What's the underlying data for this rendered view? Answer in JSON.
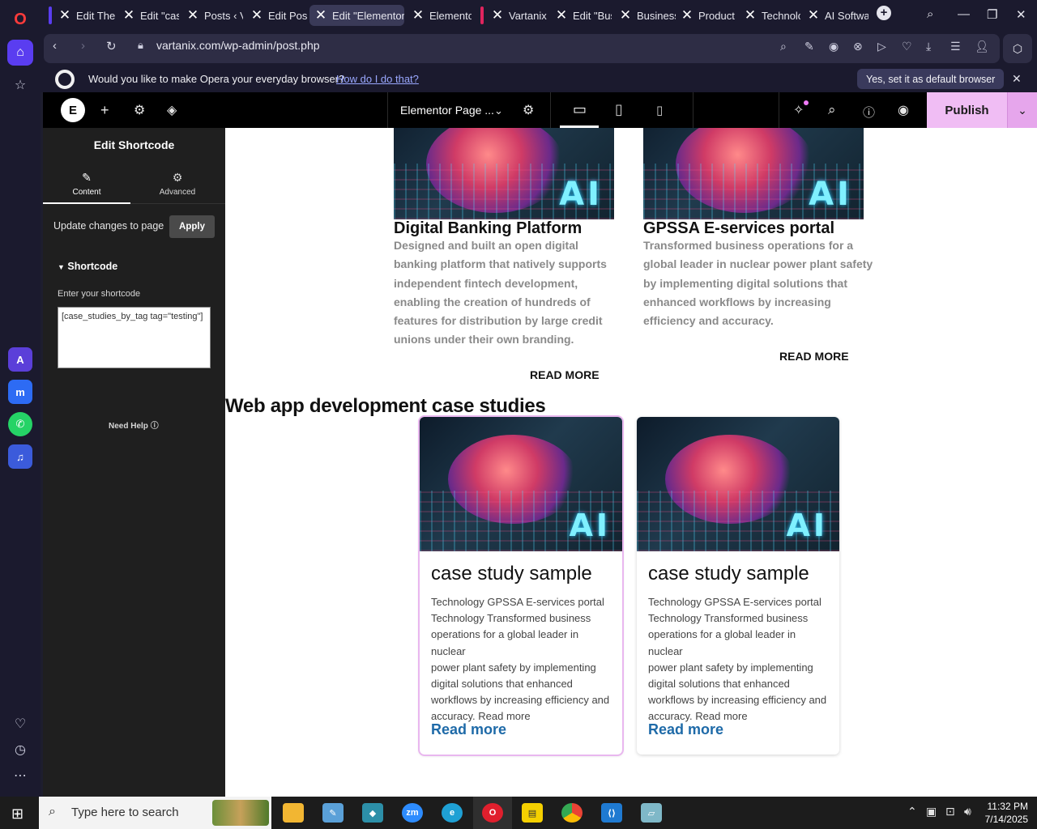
{
  "browser": {
    "tabs": [
      {
        "label": "Edit Ther",
        "active": false
      },
      {
        "label": "Edit \"case",
        "active": false
      },
      {
        "label": "Posts ‹ Va",
        "active": false
      },
      {
        "label": "Edit Post",
        "active": false
      },
      {
        "label": "Edit \"Elementor",
        "active": true
      },
      {
        "label": "Elemento",
        "active": false
      },
      {
        "label": "Vartanix |",
        "active": false
      },
      {
        "label": "Edit \"Bus",
        "active": false
      },
      {
        "label": "Business",
        "active": false
      },
      {
        "label": "Product",
        "active": false
      },
      {
        "label": "Technolo",
        "active": false
      },
      {
        "label": "AI Softwa",
        "active": false
      }
    ],
    "url": "vartanix.com/wp-admin/post.php",
    "default_prompt": {
      "text": "Would you like to make Opera your everyday browser?",
      "link": "How do I do that?",
      "button": "Yes, set it as default browser"
    }
  },
  "elementor": {
    "page_name": "Elementor Page ...",
    "publish_label": "Publish",
    "panel": {
      "title": "Edit Shortcode",
      "tabs": [
        {
          "label": "Content",
          "active": true
        },
        {
          "label": "Advanced",
          "active": false
        }
      ],
      "update_text": "Update changes to page",
      "apply_label": "Apply",
      "section_title": "Shortcode",
      "shortcode_label": "Enter your shortcode",
      "shortcode_value": "[case_studies_by_tag tag=\"testing\"]",
      "need_help": "Need Help"
    }
  },
  "canvas": {
    "top_cards": [
      {
        "title": "Digital Banking Platform",
        "desc_lines": [
          "Designed and built an open digital",
          "banking platform that natively supports",
          "independent fintech development,",
          "enabling the creation of hundreds of",
          "features for distribution by large credit",
          "unions under their own branding."
        ],
        "read_more": "READ MORE"
      },
      {
        "title": "GPSSA E-services portal",
        "desc_lines": [
          "Transformed business operations for a",
          "global leader in nuclear power plant safety",
          "by implementing digital solutions that",
          "enhanced workflows by increasing",
          "efficiency and accuracy."
        ],
        "read_more": "READ MORE"
      }
    ],
    "image_text": "AI",
    "section_heading": "Web app development case studies",
    "cards": [
      {
        "title": "case study sample",
        "body_lines": [
          "Technology GPSSA E-services portal",
          "Technology Transformed business",
          "operations for a global leader in nuclear",
          "power plant safety by implementing",
          "digital solutions that enhanced",
          "workflows by increasing efficiency and",
          "accuracy.  Read more"
        ],
        "link": "Read more",
        "selected": true
      },
      {
        "title": "case study sample",
        "body_lines": [
          "Technology GPSSA E-services portal",
          "Technology Transformed business",
          "operations for a global leader in nuclear",
          "power plant safety by implementing",
          "digital solutions that enhanced",
          "workflows by increasing efficiency and",
          "accuracy.  Read more"
        ],
        "link": "Read more",
        "selected": false
      }
    ]
  },
  "taskbar": {
    "search_placeholder": "Type here to search",
    "time": "11:32 PM",
    "date": "7/14/2025",
    "apps": [
      "file-explorer",
      "paint-app",
      "gem-app",
      "zoom",
      "edge",
      "opera",
      "sticky-notes",
      "chrome",
      "vscode",
      "notepad-app"
    ]
  },
  "colors": {
    "opera_accent": "#5a3df0",
    "publish_bg": "#f0bdf4",
    "link_blue": "#1e6aa8",
    "selection_outline": "#e9b7ef"
  }
}
